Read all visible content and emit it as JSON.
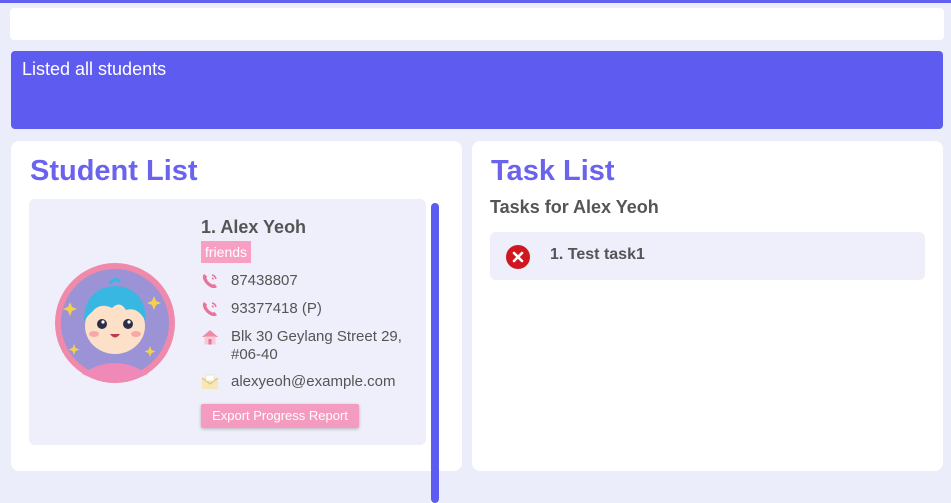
{
  "result_message": "Listed all students",
  "student_panel": {
    "title": "Student List",
    "students": [
      {
        "index_name": "1.  Alex Yeoh",
        "tag": "friends",
        "phone": "87438807",
        "parent_phone": "93377418 (P)",
        "address": "Blk 30 Geylang Street 29, #06-40",
        "email": "alexyeoh@example.com",
        "export_label": "Export Progress Report"
      }
    ]
  },
  "task_panel": {
    "title": "Task List",
    "subtitle": "Tasks for Alex Yeoh",
    "tasks": [
      {
        "label": "1. Test task1",
        "status_icon": "incomplete-x-icon"
      }
    ]
  },
  "colors": {
    "accent": "#5e5cf0",
    "title": "#6b63ee",
    "tag": "#f8a0c4",
    "card": "#efeefb",
    "incomplete": "#d0161e"
  }
}
